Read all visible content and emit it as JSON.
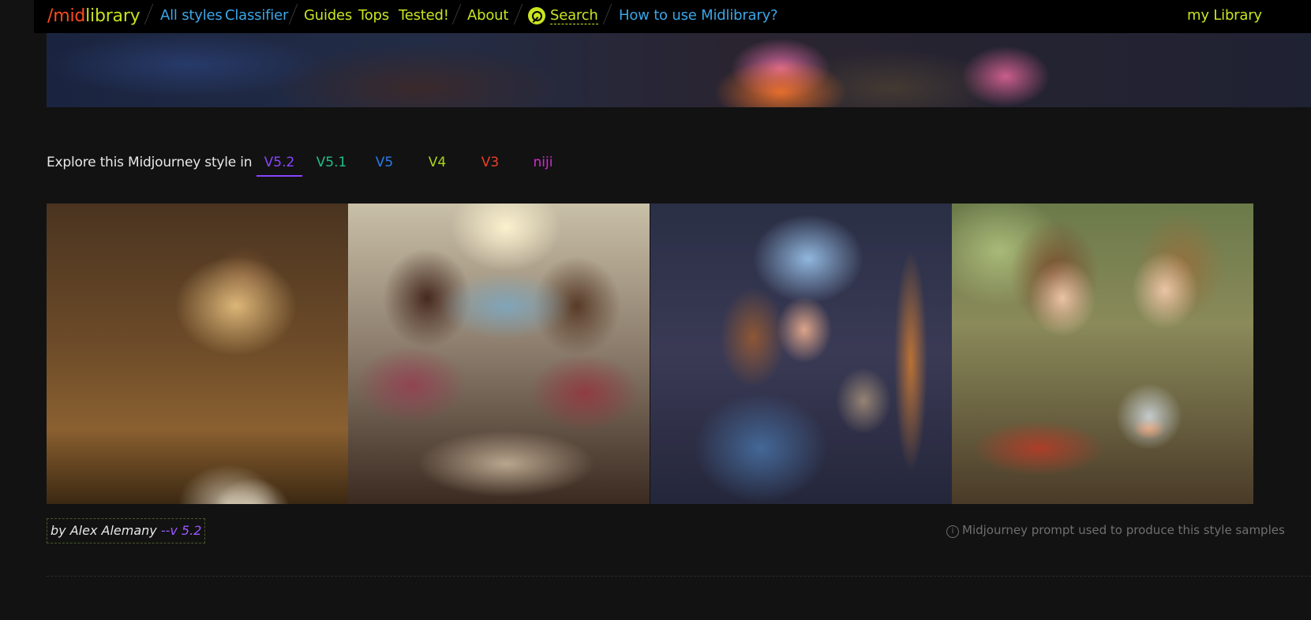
{
  "nav": {
    "logo_part1": "/mid",
    "logo_part2": "library",
    "all_styles": "All styles",
    "classifier": "Classifier",
    "guides": "Guides",
    "tops": "Tops",
    "tested": "Tested!",
    "about": "About",
    "search": "Search",
    "how_to": "How to use Midlibrary?",
    "my_library": "my Library"
  },
  "colors": {
    "blue_link": "#3ba6e8",
    "lime_link": "#c9e51f",
    "logo_mid": "#ff4a1c",
    "logo_library": "#c8e01c"
  },
  "explore": {
    "text": "Explore this Midjourney style in",
    "versions": [
      {
        "label": "V5.2",
        "color": "#8a45ff",
        "active": true
      },
      {
        "label": "V5.1",
        "color": "#1fbf8a",
        "active": false
      },
      {
        "label": "V5",
        "color": "#2a7be8",
        "active": false
      },
      {
        "label": "V4",
        "color": "#a8d61a",
        "active": false
      },
      {
        "label": "V3",
        "color": "#e8402a",
        "active": false
      },
      {
        "label": "niji",
        "color": "#d42ad4",
        "active": false
      }
    ]
  },
  "gallery": {
    "images": [
      {
        "subject": "child reading among flying pages and kittens"
      },
      {
        "subject": "girls playing with glass pieces by a window"
      },
      {
        "subject": "girl in blue hood with a cat in a doorway"
      },
      {
        "subject": "children with a goldfish bowl and tomatoes"
      }
    ]
  },
  "attribution": {
    "prefix": "by Alex Alemany",
    "param": "--v 5.2"
  },
  "prompt_note": {
    "icon": "ⓘ",
    "text": "Midjourney prompt used to produce this style samples"
  }
}
